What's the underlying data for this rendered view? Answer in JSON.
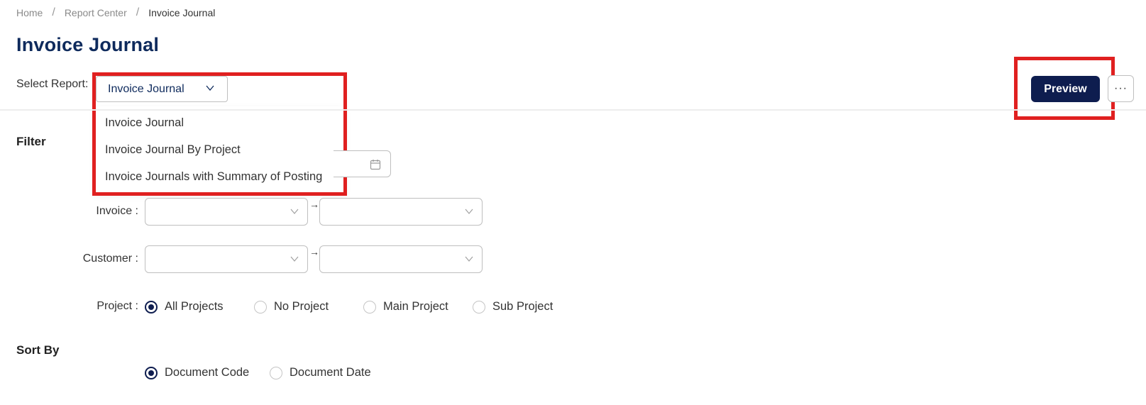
{
  "breadcrumb": {
    "home": "Home",
    "report_center": "Report Center",
    "current": "Invoice Journal",
    "separator": "/"
  },
  "page_title": "Invoice Journal",
  "select_report": {
    "label": "Select Report:",
    "value": "Invoice Journal",
    "options": [
      "Invoice Journal",
      "Invoice Journal By Project",
      "Invoice Journals with Summary of Posting"
    ]
  },
  "actions": {
    "preview": "Preview",
    "more": "···"
  },
  "filter": {
    "heading": "Filter",
    "invoice_label": "Invoice :",
    "customer_label": "Customer :",
    "range_arrow": "→",
    "project_label": "Project :",
    "project_options": [
      "All Projects",
      "No Project",
      "Main Project",
      "Sub Project"
    ],
    "project_selected": "All Projects"
  },
  "sort_by": {
    "heading": "Sort By",
    "options": [
      "Document Code",
      "Document Date"
    ],
    "selected": "Document Code"
  },
  "colors": {
    "primary": "#0e1d4f",
    "title": "#0e2a5c",
    "highlight": "#e02020"
  }
}
